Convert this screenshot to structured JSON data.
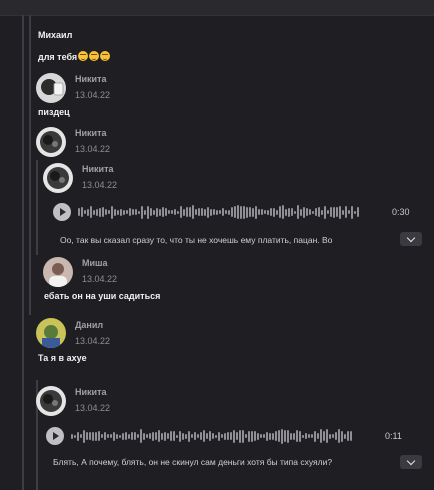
{
  "messages": [
    {
      "author": "Михаил",
      "text": "для тебя"
    },
    {
      "author": "Никита",
      "date": "13.04.22",
      "text": "пиздец"
    },
    {
      "author": "Никита",
      "date": "13.04.22"
    },
    {
      "author": "Никита",
      "date": "13.04.22",
      "voice": {
        "duration": "0:30",
        "transcript": "Оо, так вы сказал сразу то, что ты не хочешь ему платить, пацан. Во"
      }
    },
    {
      "author": "Миша",
      "date": "13.04.22",
      "text": "ебать он на уши садиться"
    },
    {
      "author": "Данил",
      "date": "13.04.22",
      "text": "Та я в ахуе"
    },
    {
      "author": "Никита",
      "date": "13.04.22",
      "voice": {
        "duration": "0:11",
        "transcript": "Блять, А почему, блять, он не скинул сам деньги хотя бы типа схуяли?"
      }
    }
  ],
  "emoji": [
    "flushed-face",
    "flushed-face",
    "flushed-face"
  ],
  "colors": {
    "background": "#1f1f23",
    "thread_line": "#3d3d44",
    "text": "#f0f0f0",
    "meta": "#8d8d93"
  }
}
